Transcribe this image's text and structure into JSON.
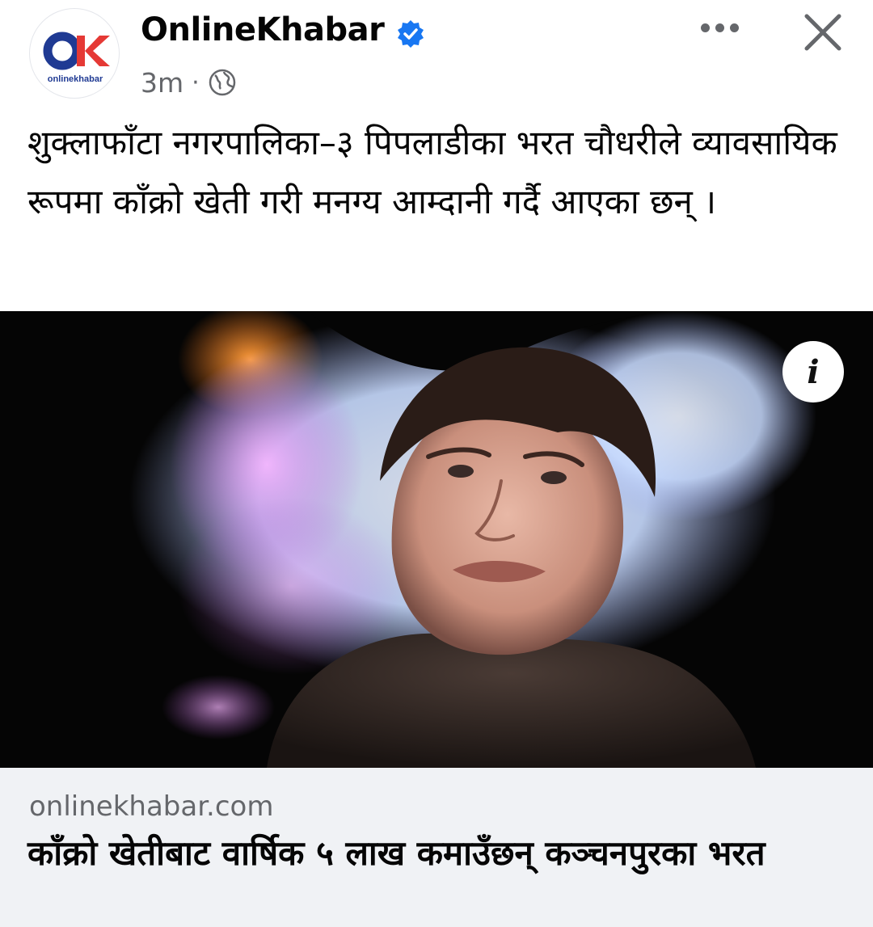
{
  "post": {
    "page_name": "OnlineKhabar",
    "avatar_logo_text": "onlinekhabar",
    "timestamp": "3m",
    "separator": "·",
    "audience_icon": "globe-icon",
    "verified_icon": "verified-badge-icon",
    "text": "शुक्लाफाँटा नगरपालिका–३ पिपलाडीका भरत चौधरीले व्यावसायिक रूपमा काँक्रो खेती गरी मनग्य आम्दानी गर्दै आएका छन् ।"
  },
  "link_preview": {
    "domain": "onlinekhabar.com",
    "title": "काँक्रो खेतीबाट वार्षिक ५ लाख कमाउँछन् कञ्चनपुरका भरत",
    "info_icon": "info-icon"
  },
  "colors": {
    "brand_blue": "#1877f2",
    "logo_red": "#e53935",
    "logo_navy": "#1f3a93",
    "secondary_text": "#65676b",
    "card_bg": "#f0f2f5"
  }
}
